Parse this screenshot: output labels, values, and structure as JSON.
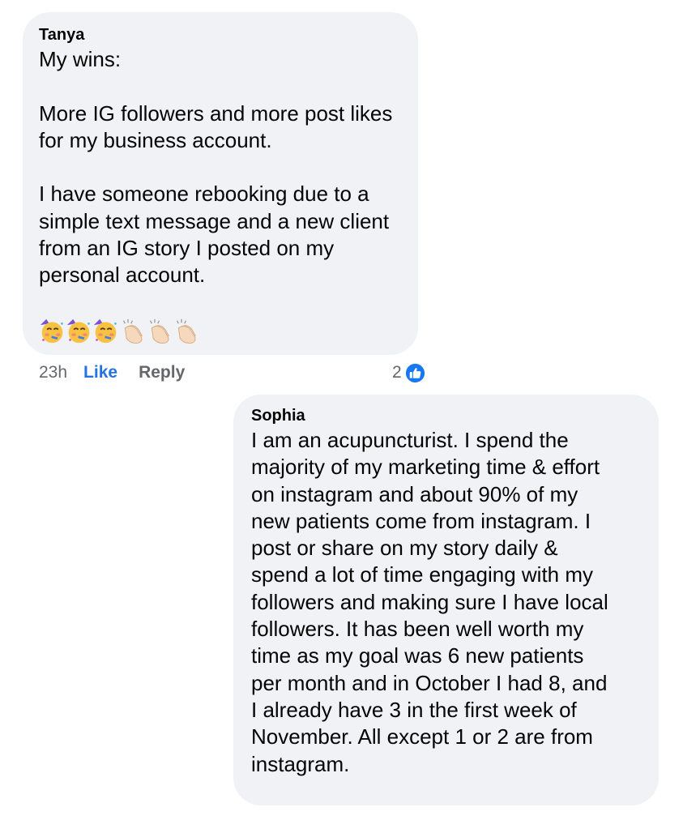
{
  "comments": [
    {
      "author": "Tanya",
      "text": "My wins:\n\nMore IG followers and more post likes\nfor my business account.\n\nI have someone rebooking due to a\nsimple text message and a new client\nfrom an IG story I posted on my\npersonal account.",
      "emojis": [
        "partying-face",
        "partying-face",
        "partying-face",
        "clapping-hands",
        "clapping-hands",
        "clapping-hands"
      ],
      "time": "23h",
      "like_label": "Like",
      "reply_label": "Reply",
      "reaction_count": "2",
      "reaction_icon": "like-badge-icon"
    },
    {
      "author": "Sophia",
      "text": "I am an acupuncturist. I spend the\nmajority of my marketing time & effort\non instagram and about 90% of my\nnew patients come from instagram. I\npost or share on my story daily &\nspend a lot of time engaging with my\nfollowers and making sure I have local\nfollowers. It has been well worth my\ntime as my goal was 6 new patients\nper month and in October I had 8, and\nI already have 3 in the first week of\nNovember. All except 1 or 2 are from\ninstagram."
    }
  ],
  "colors": {
    "bubble": "#f0f2f5",
    "text": "#050505",
    "meta": "#65676b",
    "like": "#2374e1",
    "badge": "#1877f2"
  }
}
